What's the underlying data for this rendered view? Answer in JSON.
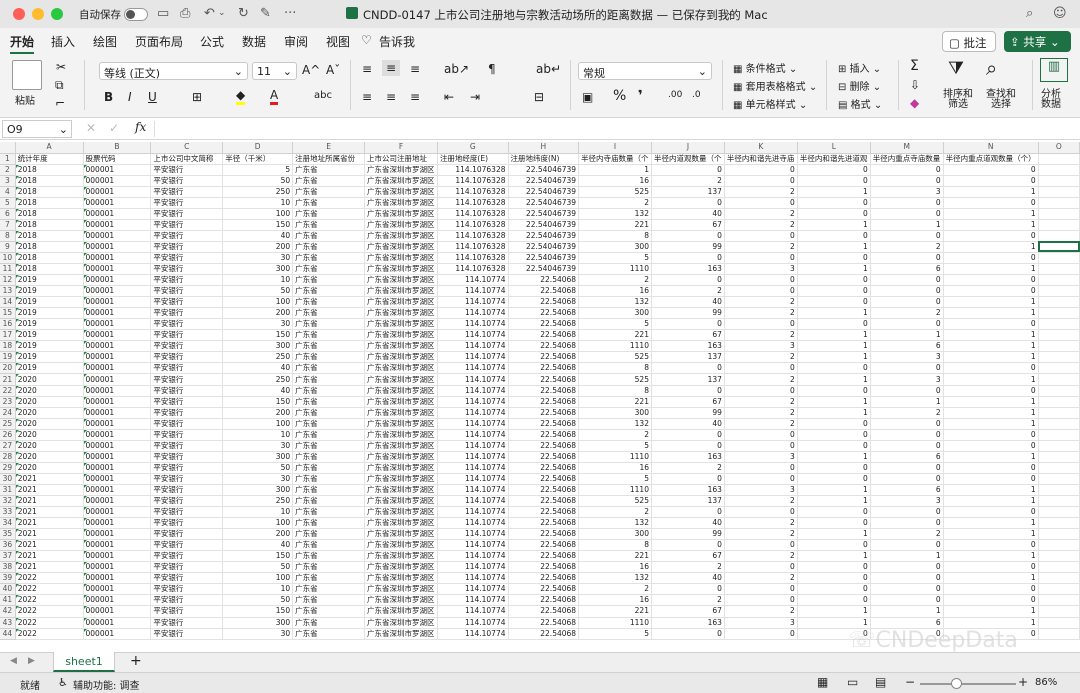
{
  "titlebar": {
    "autosave_label": "自动保存",
    "title": "CNDD-0147 上市公司注册地与宗教活动场所的距离数据 — 已保存到我的 Mac"
  },
  "tabs": [
    "开始",
    "插入",
    "绘图",
    "页面布局",
    "公式",
    "数据",
    "审阅",
    "视图",
    "告诉我"
  ],
  "ribbon": {
    "paste": "粘贴",
    "font": "等线 (正文)",
    "size": "11",
    "format": "常规",
    "cond": "条件格式",
    "table": "套用表格格式",
    "cell": "单元格样式",
    "insert": "插入",
    "delete": "删除",
    "fmt": "格式",
    "sort": "排序和\n筛选",
    "find": "查找和\n选择",
    "analyze": "分析\n数据",
    "comment": "批注",
    "share": "共享"
  },
  "formula": {
    "cell": "O9",
    "fx": "fx"
  },
  "columns": [
    "A",
    "B",
    "C",
    "D",
    "E",
    "F",
    "G",
    "H",
    "I",
    "J",
    "K",
    "L",
    "M",
    "N",
    "O"
  ],
  "header": [
    "统计年度",
    "股票代码",
    "上市公司中文简称",
    "半径（千米）",
    "注册地址所属省份",
    "上市公司注册地址",
    "注册地经度(E)",
    "注册地纬度(N)",
    "半径内寺庙数量（个",
    "半径内道观数量（个",
    "半径内和谐先进寺庙",
    "半径内和谐先进道观",
    "半径内重点寺庙数量",
    "半径内重点道观数量（个）",
    ""
  ],
  "rows": [
    [
      "2018",
      "000001",
      "平安银行",
      "5",
      "广东省",
      "广东省深圳市罗湖区",
      "114.1076328",
      "22.54046739",
      "1",
      "0",
      "0",
      "0",
      "0",
      "0"
    ],
    [
      "2018",
      "000001",
      "平安银行",
      "50",
      "广东省",
      "广东省深圳市罗湖区",
      "114.1076328",
      "22.54046739",
      "16",
      "2",
      "0",
      "0",
      "0",
      "0"
    ],
    [
      "2018",
      "000001",
      "平安银行",
      "250",
      "广东省",
      "广东省深圳市罗湖区",
      "114.1076328",
      "22.54046739",
      "525",
      "137",
      "2",
      "1",
      "3",
      "1"
    ],
    [
      "2018",
      "000001",
      "平安银行",
      "10",
      "广东省",
      "广东省深圳市罗湖区",
      "114.1076328",
      "22.54046739",
      "2",
      "0",
      "0",
      "0",
      "0",
      "0"
    ],
    [
      "2018",
      "000001",
      "平安银行",
      "100",
      "广东省",
      "广东省深圳市罗湖区",
      "114.1076328",
      "22.54046739",
      "132",
      "40",
      "2",
      "0",
      "0",
      "1"
    ],
    [
      "2018",
      "000001",
      "平安银行",
      "150",
      "广东省",
      "广东省深圳市罗湖区",
      "114.1076328",
      "22.54046739",
      "221",
      "67",
      "2",
      "1",
      "1",
      "1"
    ],
    [
      "2018",
      "000001",
      "平安银行",
      "40",
      "广东省",
      "广东省深圳市罗湖区",
      "114.1076328",
      "22.54046739",
      "8",
      "0",
      "0",
      "0",
      "0",
      "0"
    ],
    [
      "2018",
      "000001",
      "平安银行",
      "200",
      "广东省",
      "广东省深圳市罗湖区",
      "114.1076328",
      "22.54046739",
      "300",
      "99",
      "2",
      "1",
      "2",
      "1"
    ],
    [
      "2018",
      "000001",
      "平安银行",
      "30",
      "广东省",
      "广东省深圳市罗湖区",
      "114.1076328",
      "22.54046739",
      "5",
      "0",
      "0",
      "0",
      "0",
      "0"
    ],
    [
      "2018",
      "000001",
      "平安银行",
      "300",
      "广东省",
      "广东省深圳市罗湖区",
      "114.1076328",
      "22.54046739",
      "1110",
      "163",
      "3",
      "1",
      "6",
      "1"
    ],
    [
      "2019",
      "000001",
      "平安银行",
      "10",
      "广东省",
      "广东省深圳市罗湖区",
      "114.10774",
      "22.54068",
      "2",
      "0",
      "0",
      "0",
      "0",
      "0"
    ],
    [
      "2019",
      "000001",
      "平安银行",
      "50",
      "广东省",
      "广东省深圳市罗湖区",
      "114.10774",
      "22.54068",
      "16",
      "2",
      "0",
      "0",
      "0",
      "0"
    ],
    [
      "2019",
      "000001",
      "平安银行",
      "100",
      "广东省",
      "广东省深圳市罗湖区",
      "114.10774",
      "22.54068",
      "132",
      "40",
      "2",
      "0",
      "0",
      "1"
    ],
    [
      "2019",
      "000001",
      "平安银行",
      "200",
      "广东省",
      "广东省深圳市罗湖区",
      "114.10774",
      "22.54068",
      "300",
      "99",
      "2",
      "1",
      "2",
      "1"
    ],
    [
      "2019",
      "000001",
      "平安银行",
      "30",
      "广东省",
      "广东省深圳市罗湖区",
      "114.10774",
      "22.54068",
      "5",
      "0",
      "0",
      "0",
      "0",
      "0"
    ],
    [
      "2019",
      "000001",
      "平安银行",
      "150",
      "广东省",
      "广东省深圳市罗湖区",
      "114.10774",
      "22.54068",
      "221",
      "67",
      "2",
      "1",
      "1",
      "1"
    ],
    [
      "2019",
      "000001",
      "平安银行",
      "300",
      "广东省",
      "广东省深圳市罗湖区",
      "114.10774",
      "22.54068",
      "1110",
      "163",
      "3",
      "1",
      "6",
      "1"
    ],
    [
      "2019",
      "000001",
      "平安银行",
      "250",
      "广东省",
      "广东省深圳市罗湖区",
      "114.10774",
      "22.54068",
      "525",
      "137",
      "2",
      "1",
      "3",
      "1"
    ],
    [
      "2019",
      "000001",
      "平安银行",
      "40",
      "广东省",
      "广东省深圳市罗湖区",
      "114.10774",
      "22.54068",
      "8",
      "0",
      "0",
      "0",
      "0",
      "0"
    ],
    [
      "2020",
      "000001",
      "平安银行",
      "250",
      "广东省",
      "广东省深圳市罗湖区",
      "114.10774",
      "22.54068",
      "525",
      "137",
      "2",
      "1",
      "3",
      "1"
    ],
    [
      "2020",
      "000001",
      "平安银行",
      "40",
      "广东省",
      "广东省深圳市罗湖区",
      "114.10774",
      "22.54068",
      "8",
      "0",
      "0",
      "0",
      "0",
      "0"
    ],
    [
      "2020",
      "000001",
      "平安银行",
      "150",
      "广东省",
      "广东省深圳市罗湖区",
      "114.10774",
      "22.54068",
      "221",
      "67",
      "2",
      "1",
      "1",
      "1"
    ],
    [
      "2020",
      "000001",
      "平安银行",
      "200",
      "广东省",
      "广东省深圳市罗湖区",
      "114.10774",
      "22.54068",
      "300",
      "99",
      "2",
      "1",
      "2",
      "1"
    ],
    [
      "2020",
      "000001",
      "平安银行",
      "100",
      "广东省",
      "广东省深圳市罗湖区",
      "114.10774",
      "22.54068",
      "132",
      "40",
      "2",
      "0",
      "0",
      "1"
    ],
    [
      "2020",
      "000001",
      "平安银行",
      "10",
      "广东省",
      "广东省深圳市罗湖区",
      "114.10774",
      "22.54068",
      "2",
      "0",
      "0",
      "0",
      "0",
      "0"
    ],
    [
      "2020",
      "000001",
      "平安银行",
      "30",
      "广东省",
      "广东省深圳市罗湖区",
      "114.10774",
      "22.54068",
      "5",
      "0",
      "0",
      "0",
      "0",
      "0"
    ],
    [
      "2020",
      "000001",
      "平安银行",
      "300",
      "广东省",
      "广东省深圳市罗湖区",
      "114.10774",
      "22.54068",
      "1110",
      "163",
      "3",
      "1",
      "6",
      "1"
    ],
    [
      "2020",
      "000001",
      "平安银行",
      "50",
      "广东省",
      "广东省深圳市罗湖区",
      "114.10774",
      "22.54068",
      "16",
      "2",
      "0",
      "0",
      "0",
      "0"
    ],
    [
      "2021",
      "000001",
      "平安银行",
      "30",
      "广东省",
      "广东省深圳市罗湖区",
      "114.10774",
      "22.54068",
      "5",
      "0",
      "0",
      "0",
      "0",
      "0"
    ],
    [
      "2021",
      "000001",
      "平安银行",
      "300",
      "广东省",
      "广东省深圳市罗湖区",
      "114.10774",
      "22.54068",
      "1110",
      "163",
      "3",
      "1",
      "6",
      "1"
    ],
    [
      "2021",
      "000001",
      "平安银行",
      "250",
      "广东省",
      "广东省深圳市罗湖区",
      "114.10774",
      "22.54068",
      "525",
      "137",
      "2",
      "1",
      "3",
      "1"
    ],
    [
      "2021",
      "000001",
      "平安银行",
      "10",
      "广东省",
      "广东省深圳市罗湖区",
      "114.10774",
      "22.54068",
      "2",
      "0",
      "0",
      "0",
      "0",
      "0"
    ],
    [
      "2021",
      "000001",
      "平安银行",
      "100",
      "广东省",
      "广东省深圳市罗湖区",
      "114.10774",
      "22.54068",
      "132",
      "40",
      "2",
      "0",
      "0",
      "1"
    ],
    [
      "2021",
      "000001",
      "平安银行",
      "200",
      "广东省",
      "广东省深圳市罗湖区",
      "114.10774",
      "22.54068",
      "300",
      "99",
      "2",
      "1",
      "2",
      "1"
    ],
    [
      "2021",
      "000001",
      "平安银行",
      "40",
      "广东省",
      "广东省深圳市罗湖区",
      "114.10774",
      "22.54068",
      "8",
      "0",
      "0",
      "0",
      "0",
      "0"
    ],
    [
      "2021",
      "000001",
      "平安银行",
      "150",
      "广东省",
      "广东省深圳市罗湖区",
      "114.10774",
      "22.54068",
      "221",
      "67",
      "2",
      "1",
      "1",
      "1"
    ],
    [
      "2021",
      "000001",
      "平安银行",
      "50",
      "广东省",
      "广东省深圳市罗湖区",
      "114.10774",
      "22.54068",
      "16",
      "2",
      "0",
      "0",
      "0",
      "0"
    ],
    [
      "2022",
      "000001",
      "平安银行",
      "100",
      "广东省",
      "广东省深圳市罗湖区",
      "114.10774",
      "22.54068",
      "132",
      "40",
      "2",
      "0",
      "0",
      "1"
    ],
    [
      "2022",
      "000001",
      "平安银行",
      "10",
      "广东省",
      "广东省深圳市罗湖区",
      "114.10774",
      "22.54068",
      "2",
      "0",
      "0",
      "0",
      "0",
      "0"
    ],
    [
      "2022",
      "000001",
      "平安银行",
      "50",
      "广东省",
      "广东省深圳市罗湖区",
      "114.10774",
      "22.54068",
      "16",
      "2",
      "0",
      "0",
      "0",
      "0"
    ],
    [
      "2022",
      "000001",
      "平安银行",
      "150",
      "广东省",
      "广东省深圳市罗湖区",
      "114.10774",
      "22.54068",
      "221",
      "67",
      "2",
      "1",
      "1",
      "1"
    ],
    [
      "2022",
      "000001",
      "平安银行",
      "300",
      "广东省",
      "广东省深圳市罗湖区",
      "114.10774",
      "22.54068",
      "1110",
      "163",
      "3",
      "1",
      "6",
      "1"
    ],
    [
      "2022",
      "000001",
      "平安银行",
      "30",
      "广东省",
      "广东省深圳市罗湖区",
      "114.10774",
      "22.54068",
      "5",
      "0",
      "0",
      "0",
      "0",
      "0"
    ]
  ],
  "sheet": "sheet1",
  "status": {
    "ready": "就绪",
    "a11y": "辅助功能: 调查",
    "zoom": "86%"
  },
  "watermark": "CNDeepData"
}
